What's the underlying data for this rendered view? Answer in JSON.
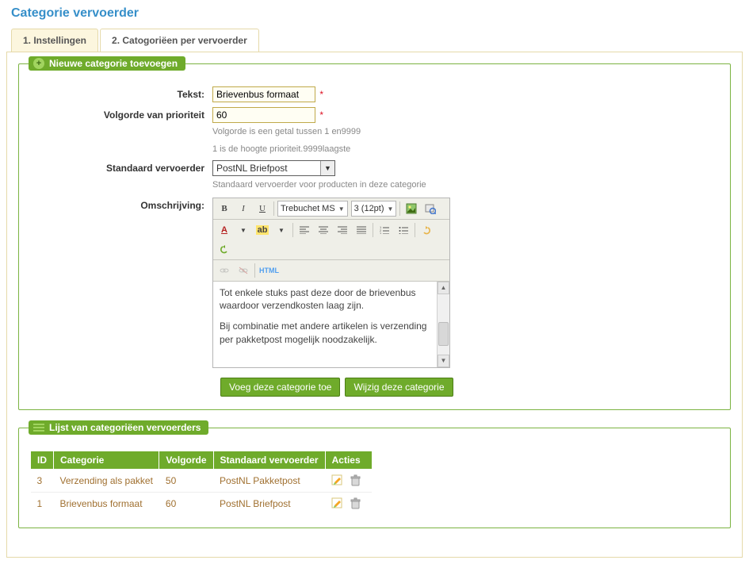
{
  "page": {
    "title": "Categorie vervoerder"
  },
  "tabs": [
    {
      "label": "1. Instellingen",
      "active": true
    },
    {
      "label": "2. Catogoriëen per vervoerder",
      "active": false
    }
  ],
  "form_group": {
    "title": "Nieuwe categorie toevoegen",
    "labels": {
      "tekst": "Tekst:",
      "volgorde": "Volgorde van prioriteit",
      "standaard": "Standaard vervoerder",
      "omschrijving": "Omschrijving:"
    },
    "values": {
      "tekst": "Brievenbus formaat",
      "volgorde": "60",
      "standaard_selected": "PostNL Briefpost"
    },
    "hints": {
      "volgorde1": "Volgorde is een getal tussen 1 en9999",
      "volgorde2": "1 is de hoogte prioriteit.9999laagste",
      "standaard": "Standaard vervoerder voor producten in deze categorie"
    },
    "editor": {
      "font_family": "Trebuchet MS",
      "font_size": "3 (12pt)",
      "html_label": "HTML",
      "body_p1": "Tot enkele stuks past deze door de brievenbus waardoor verzendkosten laag zijn.",
      "body_p2": "Bij combinatie met andere artikelen is verzending per pakketpost mogelijk noodzakelijk."
    },
    "buttons": {
      "add": "Voeg deze categorie toe",
      "edit": "Wijzig deze categorie"
    }
  },
  "list_group": {
    "title": "Lijst van categoriëen vervoerders",
    "columns": {
      "id": "ID",
      "categorie": "Categorie",
      "volgorde": "Volgorde",
      "standaard": "Standaard vervoerder",
      "acties": "Acties"
    },
    "rows": [
      {
        "id": "3",
        "categorie": "Verzending als pakket",
        "volgorde": "50",
        "standaard": "PostNL Pakketpost"
      },
      {
        "id": "1",
        "categorie": "Brievenbus formaat",
        "volgorde": "60",
        "standaard": "PostNL Briefpost"
      }
    ]
  }
}
